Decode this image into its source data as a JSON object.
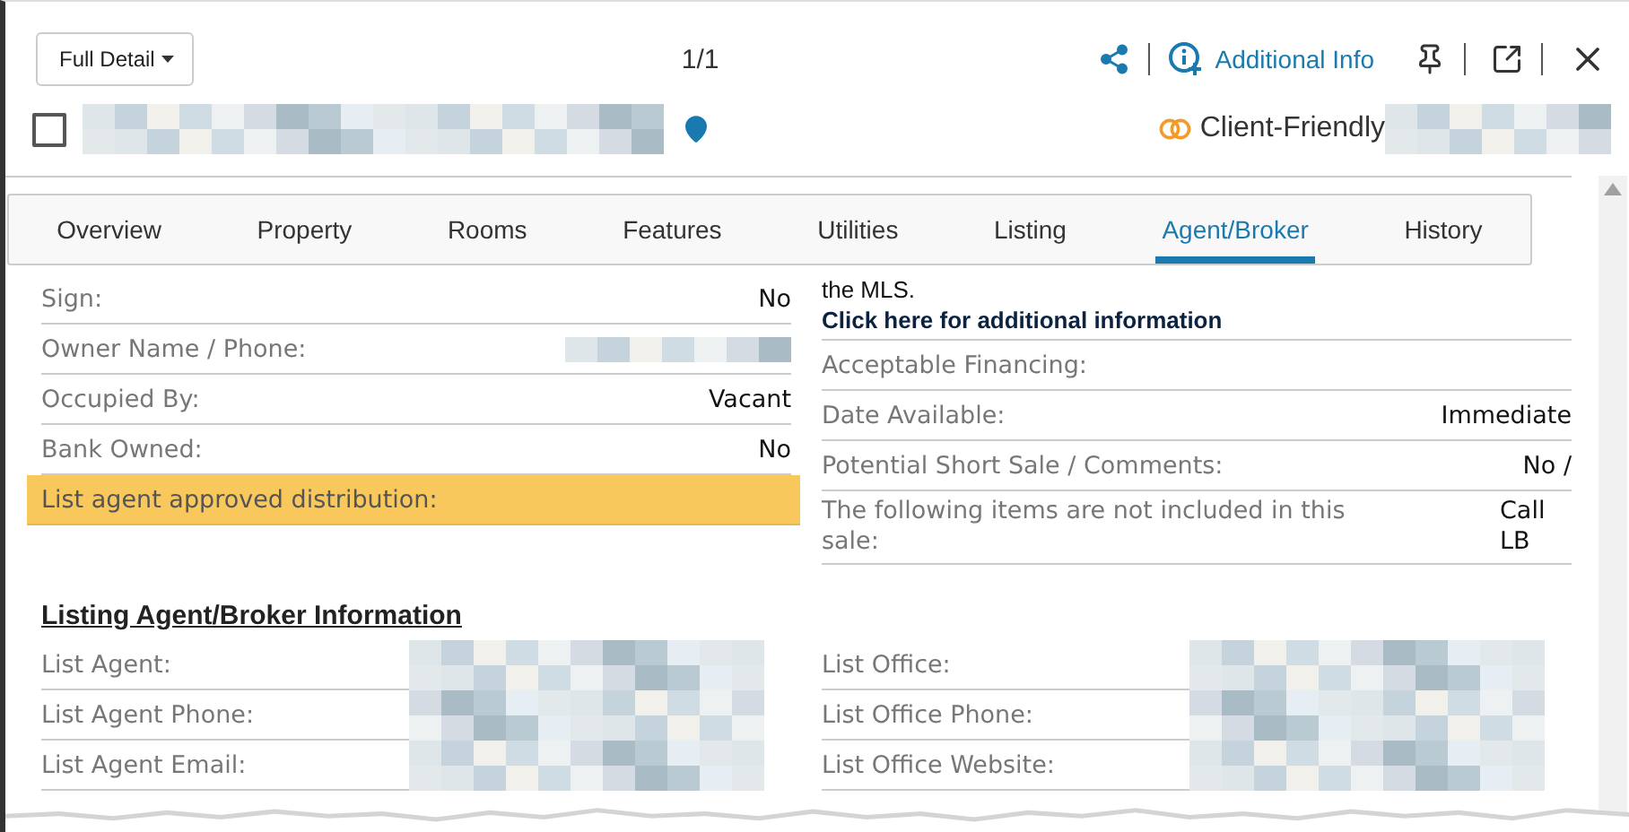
{
  "header": {
    "view_button": "Full Detail",
    "pager": "1/1",
    "additional_info": "Additional Info"
  },
  "record": {
    "checked": false,
    "client_friendly": "Client-Friendly"
  },
  "tabs": [
    {
      "label": "Overview",
      "selected": false
    },
    {
      "label": "Property",
      "selected": false
    },
    {
      "label": "Rooms",
      "selected": false
    },
    {
      "label": "Features",
      "selected": false
    },
    {
      "label": "Utilities",
      "selected": false
    },
    {
      "label": "Listing",
      "selected": false
    },
    {
      "label": "Agent/Broker",
      "selected": true
    },
    {
      "label": "History",
      "selected": false
    }
  ],
  "left_fields": [
    {
      "label": "Sign:",
      "kind": "text",
      "value": "No",
      "highlighted": false
    },
    {
      "label": "Owner Name / Phone:",
      "kind": "redacted",
      "highlighted": false
    },
    {
      "label": "Occupied By:",
      "kind": "text",
      "value": "Vacant",
      "highlighted": false
    },
    {
      "label": "Bank Owned:",
      "kind": "text",
      "value": "No",
      "highlighted": false
    },
    {
      "label": "List agent approved distribution:",
      "kind": "empty",
      "highlighted": true
    }
  ],
  "notice": {
    "text": "the MLS.",
    "link": "Click here for additional information"
  },
  "right_fields": [
    {
      "label": "Acceptable Financing:",
      "kind": "empty"
    },
    {
      "label": "Date Available:",
      "kind": "text",
      "value": "Immediate"
    },
    {
      "label": "Potential Short Sale / Comments:",
      "kind": "text",
      "value": "No /"
    },
    {
      "label": "The following items are not included in this sale:",
      "kind": "text",
      "value": "Call LB"
    }
  ],
  "section_title": "Listing Agent/Broker Information",
  "agent_fields": [
    {
      "label": "List Agent:"
    },
    {
      "label": "List Agent Phone:"
    },
    {
      "label": "List Agent Email:"
    }
  ],
  "office_fields": [
    {
      "label": "List Office:"
    },
    {
      "label": "List Office Phone:"
    },
    {
      "label": "List Office Website:"
    }
  ]
}
